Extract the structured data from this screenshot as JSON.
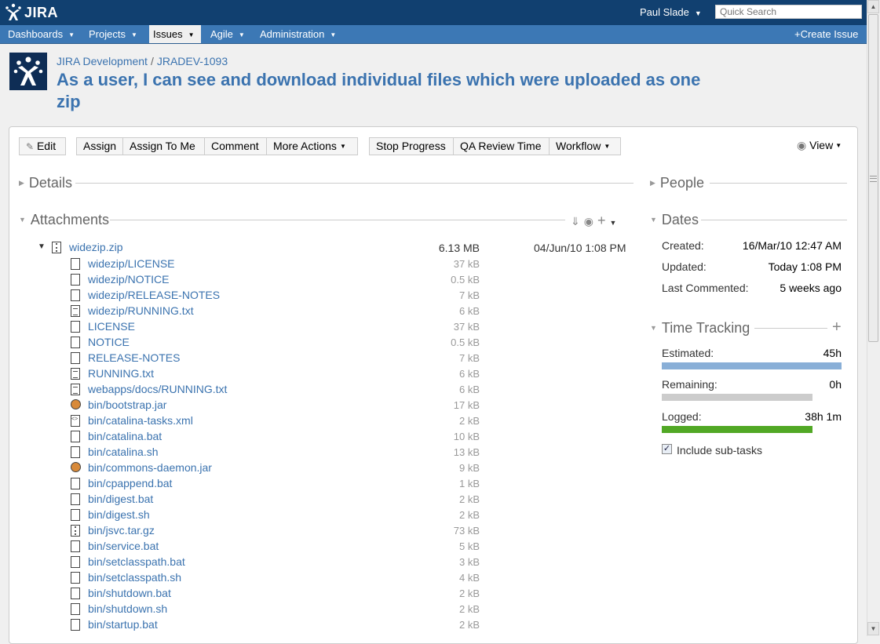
{
  "header": {
    "logo_text": "JIRA",
    "user_name": "Paul Slade",
    "search_placeholder": "Quick Search"
  },
  "nav": {
    "items": [
      {
        "label": "Dashboards"
      },
      {
        "label": "Projects"
      },
      {
        "label": "Issues"
      },
      {
        "label": "Agile"
      },
      {
        "label": "Administration"
      }
    ],
    "create_issue": "Create Issue"
  },
  "issue": {
    "project": "JIRA Development",
    "key": "JRADEV-1093",
    "summary": "As a user, I can see and download individual files which were uploaded as one zip"
  },
  "toolbar": {
    "edit": "Edit",
    "assign": "Assign",
    "assign_to_me": "Assign To Me",
    "comment": "Comment",
    "more_actions": "More Actions",
    "stop_progress": "Stop Progress",
    "qa_review_time": "QA Review Time",
    "workflow": "Workflow",
    "view": "View"
  },
  "modules": {
    "details": "Details",
    "attachments": "Attachments",
    "people": "People",
    "dates": "Dates",
    "time_tracking": "Time Tracking"
  },
  "attachments": {
    "zip": {
      "name": "widezip.zip",
      "size": "6.13 MB",
      "date": "04/Jun/10 1:08 PM"
    },
    "files": [
      {
        "name": "widezip/LICENSE",
        "size": "37 kB",
        "icon": "generic-file-icon"
      },
      {
        "name": "widezip/NOTICE",
        "size": "0.5 kB",
        "icon": "generic-file-icon"
      },
      {
        "name": "widezip/RELEASE-NOTES",
        "size": "7 kB",
        "icon": "generic-file-icon"
      },
      {
        "name": "widezip/RUNNING.txt",
        "size": "6 kB",
        "icon": "text-file-icon"
      },
      {
        "name": "LICENSE",
        "size": "37 kB",
        "icon": "generic-file-icon"
      },
      {
        "name": "NOTICE",
        "size": "0.5 kB",
        "icon": "generic-file-icon"
      },
      {
        "name": "RELEASE-NOTES",
        "size": "7 kB",
        "icon": "generic-file-icon"
      },
      {
        "name": "RUNNING.txt",
        "size": "6 kB",
        "icon": "text-file-icon"
      },
      {
        "name": "webapps/docs/RUNNING.txt",
        "size": "6 kB",
        "icon": "text-file-icon"
      },
      {
        "name": "bin/bootstrap.jar",
        "size": "17 kB",
        "icon": "jar-file-icon"
      },
      {
        "name": "bin/catalina-tasks.xml",
        "size": "2 kB",
        "icon": "xml-file-icon"
      },
      {
        "name": "bin/catalina.bat",
        "size": "10 kB",
        "icon": "generic-file-icon"
      },
      {
        "name": "bin/catalina.sh",
        "size": "13 kB",
        "icon": "generic-file-icon"
      },
      {
        "name": "bin/commons-daemon.jar",
        "size": "9 kB",
        "icon": "jar-file-icon"
      },
      {
        "name": "bin/cpappend.bat",
        "size": "1 kB",
        "icon": "generic-file-icon"
      },
      {
        "name": "bin/digest.bat",
        "size": "2 kB",
        "icon": "generic-file-icon"
      },
      {
        "name": "bin/digest.sh",
        "size": "2 kB",
        "icon": "generic-file-icon"
      },
      {
        "name": "bin/jsvc.tar.gz",
        "size": "73 kB",
        "icon": "archive-file-icon"
      },
      {
        "name": "bin/service.bat",
        "size": "5 kB",
        "icon": "generic-file-icon"
      },
      {
        "name": "bin/setclasspath.bat",
        "size": "3 kB",
        "icon": "generic-file-icon"
      },
      {
        "name": "bin/setclasspath.sh",
        "size": "4 kB",
        "icon": "generic-file-icon"
      },
      {
        "name": "bin/shutdown.bat",
        "size": "2 kB",
        "icon": "generic-file-icon"
      },
      {
        "name": "bin/shutdown.sh",
        "size": "2 kB",
        "icon": "generic-file-icon"
      },
      {
        "name": "bin/startup.bat",
        "size": "2 kB",
        "icon": "generic-file-icon"
      }
    ]
  },
  "dates": {
    "created_label": "Created:",
    "created_value": "16/Mar/10 12:47 AM",
    "updated_label": "Updated:",
    "updated_value": "Today 1:08 PM",
    "last_commented_label": "Last Commented:",
    "last_commented_value": "5 weeks ago"
  },
  "time_tracking": {
    "estimated_label": "Estimated:",
    "estimated_value": "45h",
    "estimated_fraction": 1.0,
    "remaining_label": "Remaining:",
    "remaining_value": "0h",
    "remaining_fraction": 0.0,
    "logged_label": "Logged:",
    "logged_value": "38h 1m",
    "logged_fraction": 1.0,
    "include_subtasks": "Include sub-tasks",
    "include_subtasks_checked": true
  },
  "colors": {
    "header_bg": "#114070",
    "nav_bg": "#3c78b5",
    "link": "#3b73af",
    "estimated_bar": "#89afd7",
    "remaining_bar": "#cccccc",
    "logged_bar": "#51a825"
  }
}
